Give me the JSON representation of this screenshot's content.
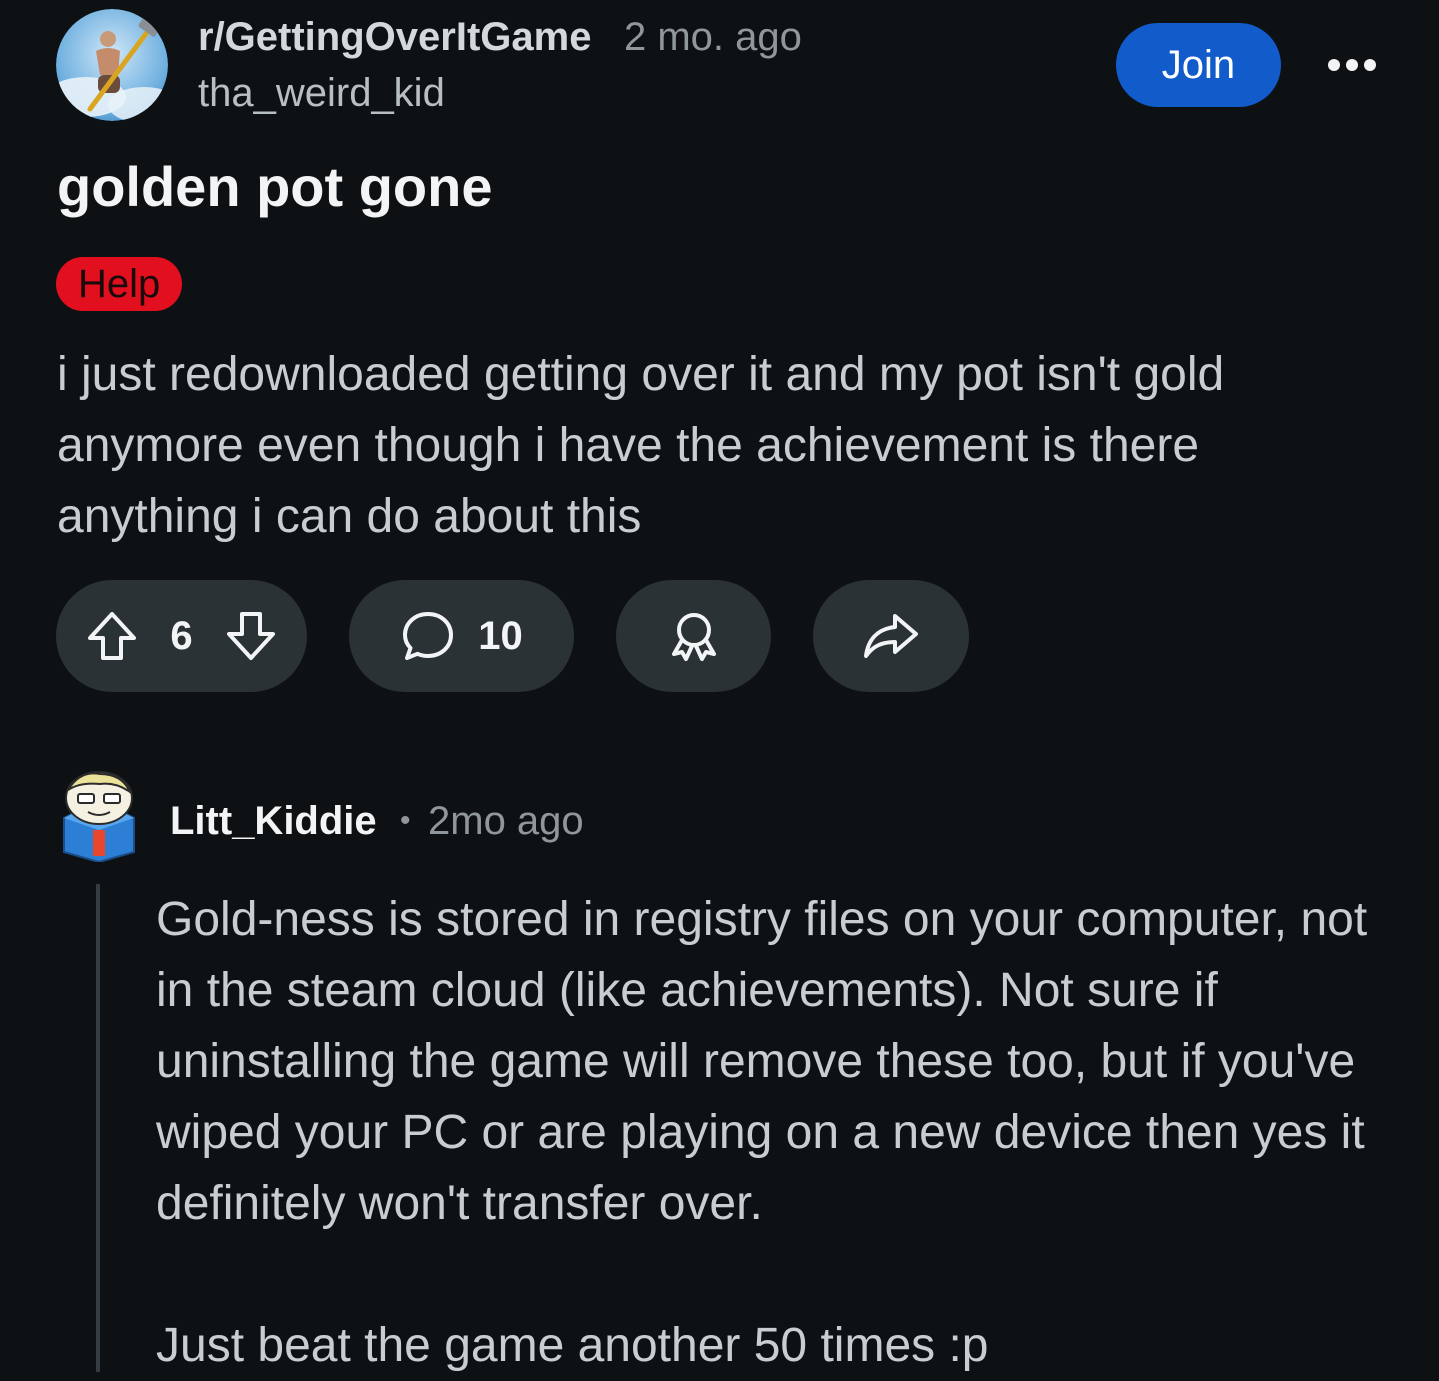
{
  "post": {
    "subreddit": "r/GettingOverItGame",
    "time": "2 mo. ago",
    "author": "tha_weird_kid",
    "join_label": "Join",
    "title": "golden pot gone",
    "flair": "Help",
    "flair_color": "#e2101f",
    "body": "i just redownloaded getting over it and my pot isn't gold anymore even though i have the achievement is there anything i can do about this",
    "score": "6",
    "comments": "10",
    "icons": {
      "avatar": "subreddit-avatar",
      "more": "more-options-icon",
      "upvote": "upvote-arrow-icon",
      "downvote": "downvote-arrow-icon",
      "comment": "comment-bubble-icon",
      "award": "award-icon",
      "share": "share-arrow-icon"
    }
  },
  "comment": {
    "author": "Litt_Kiddie",
    "separator": "•",
    "time": "2mo ago",
    "paragraphs": [
      "Gold-ness is stored in registry files on your computer, not in the steam cloud (like achievements). Not sure if uninstalling the game will remove these too, but if you've wiped your PC or are playing on a new device then yes it definitely won't transfer over.",
      "Just beat the game another 50 times :p"
    ]
  },
  "theme": {
    "background": "#0e1113",
    "pill": "#2a3236",
    "join": "#115bca"
  }
}
